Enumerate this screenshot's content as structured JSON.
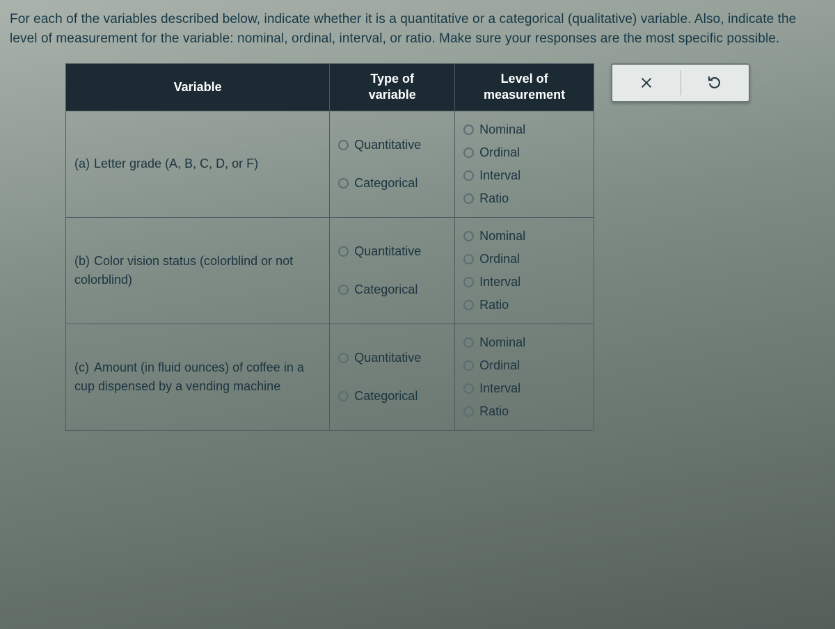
{
  "instructions": "For each of the variables described below, indicate whether it is a quantitative or a categorical (qualitative) variable. Also, indicate the level of measurement for the variable: nominal, ordinal, interval, or ratio. Make sure your responses are the most specific possible.",
  "headers": {
    "variable": "Variable",
    "type": "Type of\nvariable",
    "level": "Level of\nmeasurement"
  },
  "type_options": {
    "quantitative": "Quantitative",
    "categorical": "Categorical"
  },
  "level_options": {
    "nominal": "Nominal",
    "ordinal": "Ordinal",
    "interval": "Interval",
    "ratio": "Ratio"
  },
  "rows": [
    {
      "marker": "(a)",
      "text": "Letter grade (A, B, C, D, or F)"
    },
    {
      "marker": "(b)",
      "text": "Color vision status (colorblind or not colorblind)"
    },
    {
      "marker": "(c)",
      "text": "Amount (in fluid ounces) of coffee in a cup dispensed by a vending machine"
    }
  ],
  "toolbar": {
    "clear": "Clear",
    "reset": "Reset"
  }
}
